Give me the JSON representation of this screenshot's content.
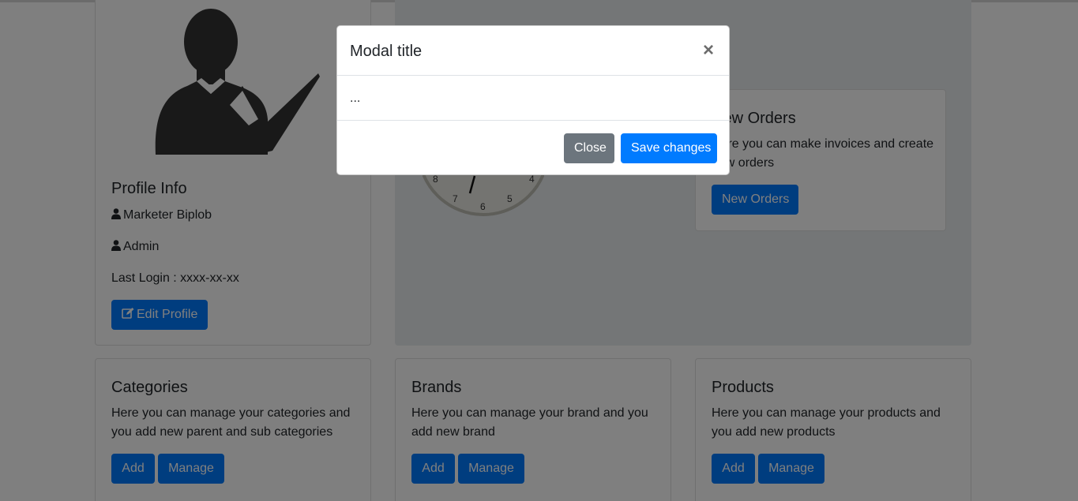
{
  "profile": {
    "title": "Profile Info",
    "name": "Marketer Biplob",
    "role": "Admin",
    "last_login": "Last Login : xxxx-xx-xx",
    "edit_button": "Edit Profile"
  },
  "clock": {
    "numbers": [
      "4",
      "5",
      "6",
      "7",
      "8"
    ]
  },
  "new_orders": {
    "title": "New Orders",
    "description": "Here you can make invoices and create new orders",
    "button": "New Orders"
  },
  "cards": [
    {
      "title": "Categories",
      "description": "Here you can manage your categories and you add new parent and sub categories",
      "add": "Add",
      "manage": "Manage"
    },
    {
      "title": "Brands",
      "description": "Here you can manage your brand and you add new brand",
      "add": "Add",
      "manage": "Manage"
    },
    {
      "title": "Products",
      "description": "Here you can manage your products and you add new products",
      "add": "Add",
      "manage": "Manage"
    }
  ],
  "modal": {
    "title": "Modal title",
    "close_symbol": "×",
    "body": "...",
    "close_button": "Close",
    "save_button": "Save changes"
  },
  "colors": {
    "primary": "#007bff",
    "secondary": "#6c757d",
    "backdrop": "rgba(0,0,0,0.5)"
  },
  "icons": [
    "user-check-avatar",
    "user-icon",
    "edit-icon",
    "close-icon"
  ]
}
